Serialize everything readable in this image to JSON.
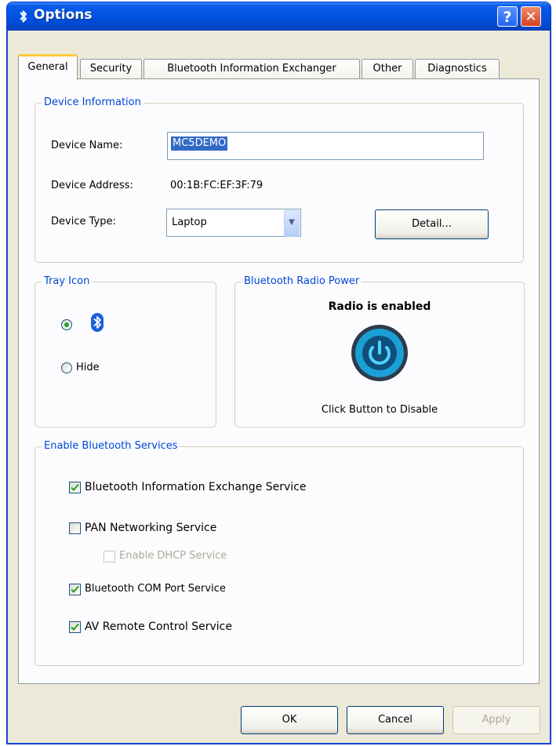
{
  "window": {
    "title": "Options"
  },
  "tabs": [
    {
      "label": "General",
      "active": true
    },
    {
      "label": "Security",
      "active": false
    },
    {
      "label": "Bluetooth Information Exchanger",
      "active": false
    },
    {
      "label": "Other",
      "active": false
    },
    {
      "label": "Diagnostics",
      "active": false
    }
  ],
  "device_info": {
    "legend": "Device Information",
    "name_label": "Device Name:",
    "name_value": "MC5DEMO",
    "address_label": "Device Address:",
    "address_value": "00:1B:FC:EF:3F:79",
    "type_label": "Device Type:",
    "type_value": "Laptop",
    "detail_button": "Detail..."
  },
  "tray_icon": {
    "legend": "Tray Icon",
    "show_selected": true,
    "hide_label": "Hide"
  },
  "radio_power": {
    "legend": "Bluetooth Radio Power",
    "status": "Radio is enabled",
    "hint": "Click Button to Disable"
  },
  "services": {
    "legend": "Enable Bluetooth Services",
    "items": [
      {
        "label": "Bluetooth Information Exchange Service",
        "checked": true,
        "enabled": true
      },
      {
        "label": "PAN Networking Service",
        "checked": false,
        "enabled": true
      },
      {
        "label": "Enable DHCP Service",
        "checked": false,
        "enabled": false
      },
      {
        "label": "Bluetooth COM Port Service",
        "checked": true,
        "enabled": true
      },
      {
        "label": "AV Remote Control Service",
        "checked": true,
        "enabled": true
      }
    ]
  },
  "footer": {
    "ok": "OK",
    "cancel": "Cancel",
    "apply": "Apply"
  },
  "colors": {
    "title_bar": "#0054e3",
    "legend_text": "#0046d5",
    "active_tab_accent": "#ffc83c",
    "power_button": "#1a9fd6"
  }
}
